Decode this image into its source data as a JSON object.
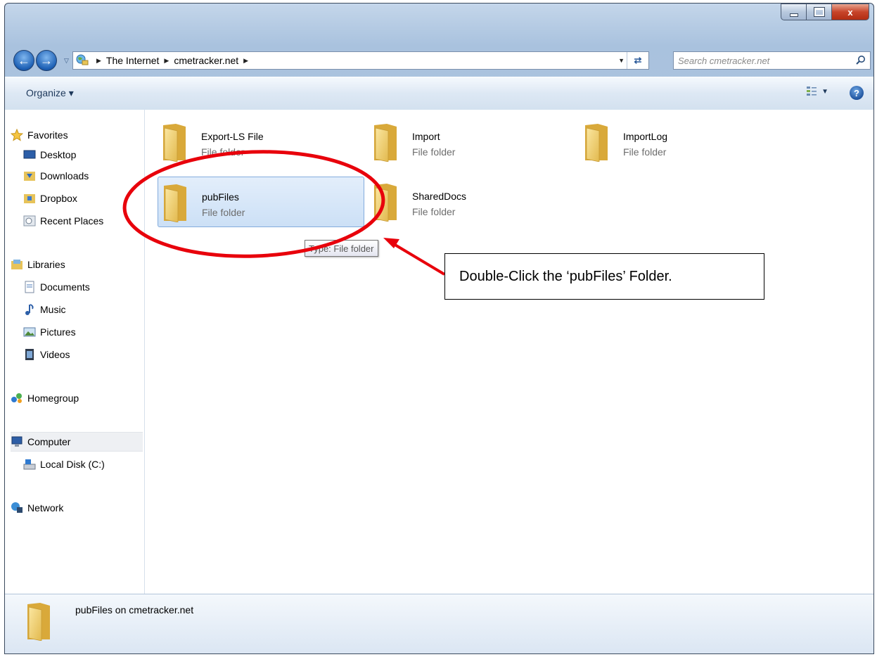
{
  "window": {
    "minimize_icon": "minimize-icon",
    "maximize_icon": "maximize-icon",
    "close_label": "x"
  },
  "address": {
    "crumbs": [
      "The Internet",
      "cmetracker.net"
    ],
    "search_placeholder": "Search cmetracker.net"
  },
  "toolbar": {
    "organize_label": "Organize ▾",
    "help_label": "?"
  },
  "sidebar": {
    "favorites": [
      "Favorites",
      "Desktop",
      "Downloads",
      "Dropbox",
      "Recent Places"
    ],
    "libraries": [
      "Libraries",
      "Documents",
      "Music",
      "Pictures",
      "Videos"
    ],
    "homegroup": "Homegroup",
    "computer": [
      "Computer",
      "Local Disk (C:)"
    ],
    "network": "Network"
  },
  "folders": [
    {
      "name": "Export-LS File",
      "type": "File folder"
    },
    {
      "name": "Import",
      "type": "File folder"
    },
    {
      "name": "ImportLog",
      "type": "File folder"
    },
    {
      "name": "pubFiles",
      "type": "File folder",
      "selected": true
    },
    {
      "name": "SharedDocs",
      "type": "File folder"
    }
  ],
  "tooltip": "Type: File folder",
  "annotation": {
    "callout_text": "Double-Click the ‘pubFiles’ Folder.",
    "ellipse_color": "#e8000b",
    "arrow_color": "#e8000b"
  },
  "statusbar": {
    "text": "pubFiles on cmetracker.net"
  }
}
